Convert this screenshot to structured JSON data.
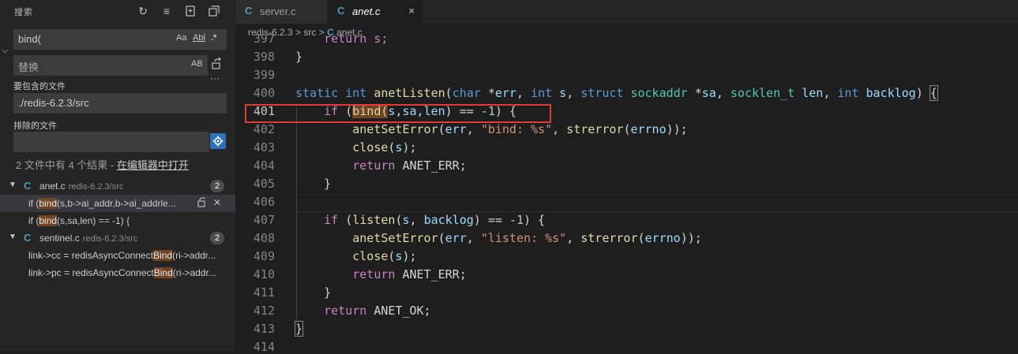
{
  "sidebar": {
    "title": "搜索",
    "actions": [
      "refresh-icon",
      "clear-results-icon",
      "new-search-editor-icon",
      "collapse-all-icon"
    ],
    "search": {
      "value": "bind(",
      "opts": [
        "Aa",
        "Abl",
        ".*"
      ]
    },
    "replace": {
      "placeholder": "替换",
      "opt": "AB"
    },
    "include_label": "要包含的文件",
    "include_value": "./redis-6.2.3/src",
    "exclude_label": "排除的文件",
    "exclude_value": "",
    "more": "···",
    "summary_prefix": "2 文件中有 4 个结果 - ",
    "summary_link": "在编辑器中打开",
    "results": [
      {
        "file": "anet.c",
        "path": "redis-6.2.3/src",
        "count": "2",
        "matches": [
          {
            "pre": "if (",
            "hit": "bind",
            "post": "(s,b->ai_addr,b->ai_addrle..."
          },
          {
            "pre": "if (",
            "hit": "bind",
            "post": "(s,sa,len) == -1) {"
          }
        ]
      },
      {
        "file": "sentinel.c",
        "path": "redis-6.2.3/src",
        "count": "2",
        "matches": [
          {
            "pre": "link->cc = redisAsyncConnect",
            "hit": "Bind",
            "post": "(ri->addr..."
          },
          {
            "pre": "link->pc = redisAsyncConnect",
            "hit": "Bind",
            "post": "(ri->addr..."
          }
        ]
      }
    ]
  },
  "editor": {
    "tabs": [
      {
        "icon": "C",
        "label": "server.c"
      },
      {
        "icon": "C",
        "label": "anet.c",
        "close": "×"
      }
    ],
    "breadcrumb": {
      "root": "redis-6.2.3",
      "sep": ">",
      "dir": "src",
      "icon": "C",
      "file": "anet.c"
    },
    "line_numbers": [
      "397",
      "398",
      "399",
      "400",
      "401",
      "402",
      "403",
      "404",
      "405",
      "406",
      "407",
      "408",
      "409",
      "410",
      "411",
      "412",
      "413",
      "414"
    ],
    "top_partial": "    return s;"
  },
  "colors": {
    "highlight_box": "#e53935",
    "match_bg": "#6f4422",
    "c_icon": "#519aba"
  }
}
